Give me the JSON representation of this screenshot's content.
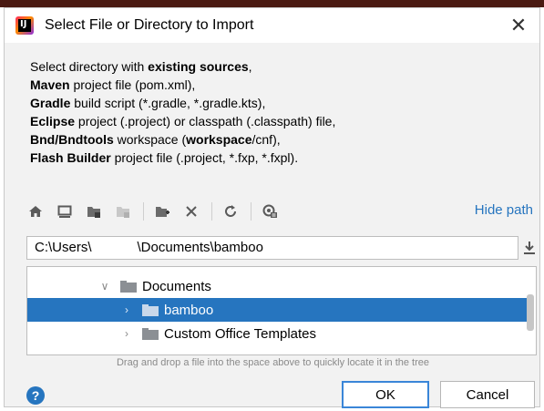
{
  "window": {
    "title": "Select File or Directory to Import",
    "app_icon_text": "IJ"
  },
  "description": {
    "lines": [
      {
        "bold": "",
        "text": "Select directory with ",
        "bold2": "existing sources",
        "tail": ","
      },
      {
        "bold": "Maven",
        "text": " project file (pom.xml),"
      },
      {
        "bold": "Gradle",
        "text": " build script (*.gradle, *.gradle.kts),"
      },
      {
        "bold": "Eclipse",
        "text": " project (.project) or classpath (.classpath) file,"
      },
      {
        "bold": "Bnd/Bndtools",
        "text": " workspace (",
        "bold2": "workspace",
        "tail": "/cnf),"
      },
      {
        "bold": "Flash Builder",
        "text": " project file (.project, *.fxp, *.fxpl)."
      }
    ]
  },
  "toolbar": {
    "icons": [
      "home-icon",
      "desktop-icon",
      "project-folder-icon",
      "module-folder-icon",
      "new-folder-icon",
      "delete-icon",
      "refresh-icon",
      "show-hidden-icon"
    ],
    "hide_path_label": "Hide path"
  },
  "path_field": {
    "value": "C:\\Users\\            \\Documents\\bamboo"
  },
  "tree": {
    "items": [
      {
        "label": "Documents",
        "expanded": true,
        "selected": false
      },
      {
        "label": "bamboo",
        "expanded": false,
        "selected": true
      },
      {
        "label": "Custom Office Templates",
        "expanded": false,
        "selected": false
      }
    ]
  },
  "hint": "Drag and drop a file into the space above to quickly locate it in the tree",
  "buttons": {
    "ok": "OK",
    "cancel": "Cancel",
    "help": "?"
  },
  "colors": {
    "accent": "#2675bf",
    "selection": "#2675bf"
  }
}
